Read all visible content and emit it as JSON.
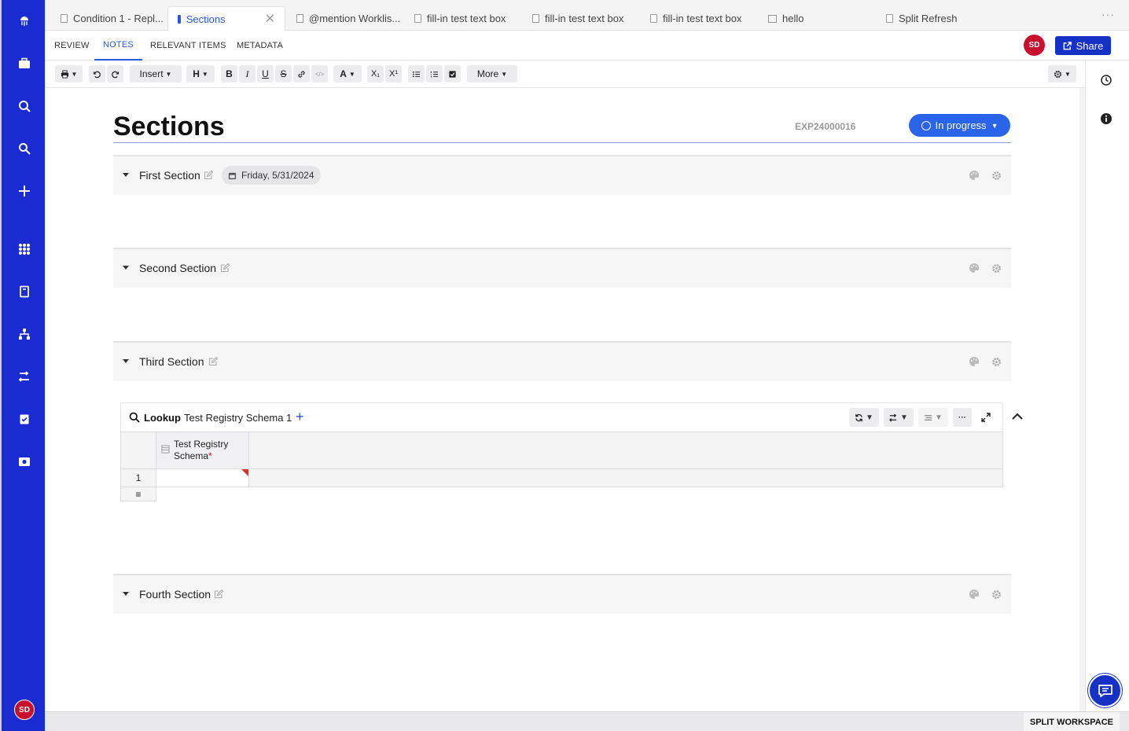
{
  "leftnav": {
    "icons": [
      "jellyfish-logo-icon",
      "briefcase-icon",
      "dashboard-search-icon",
      "search-icon",
      "plus-icon",
      "apps-grid-icon",
      "notebook-icon",
      "hierarchy-icon",
      "workflow-icon",
      "clipboard-check-icon",
      "camera-folder-icon"
    ],
    "avatar": "SD"
  },
  "tabs": [
    {
      "label": "Condition 1 - Repl..."
    },
    {
      "label": "Sections"
    },
    {
      "label": "@mention Worklis..."
    },
    {
      "label": "fill-in test text box"
    },
    {
      "label": "fill-in test text box"
    },
    {
      "label": "fill-in test text box"
    },
    {
      "label": "hello"
    },
    {
      "label": "Split Refresh"
    }
  ],
  "tabbar_more": "···",
  "subnav": {
    "tabs": [
      "REVIEW",
      "NOTES",
      "RELEVANT ITEMS",
      "METADATA"
    ],
    "avatar": "SD",
    "share_label": "Share"
  },
  "toolbar": {
    "insert_label": "Insert",
    "heading_label": "H",
    "bold": "B",
    "italic": "I",
    "underline": "U",
    "strike": "S",
    "code": "</>",
    "font_color": "A",
    "subscript": "X₁",
    "superscript": "X¹",
    "more_label": "More"
  },
  "document": {
    "title": "Sections",
    "id": "EXP24000016",
    "status": "In progress"
  },
  "sections": [
    {
      "title": "First Section",
      "date": "Friday, 5/31/2024"
    },
    {
      "title": "Second Section"
    },
    {
      "title": "Third Section"
    },
    {
      "title": "Fourth Section"
    }
  ],
  "lookup": {
    "label": "Lookup",
    "schema": "Test Registry Schema 1",
    "add": "+",
    "column_header_line1": "Test Registry",
    "column_header_line2": "Schema",
    "required_mark": "*",
    "row_number": "1",
    "row_menu": "≡",
    "more": "···"
  },
  "footer": {
    "split_workspace": "SPLIT WORKSPACE"
  },
  "colors": {
    "nav_blue": "#1a2bd1",
    "accent_blue": "#2a59d8",
    "share_blue": "#1632c6",
    "status_blue": "#2a64e8",
    "avatar_red": "#c8102e"
  }
}
